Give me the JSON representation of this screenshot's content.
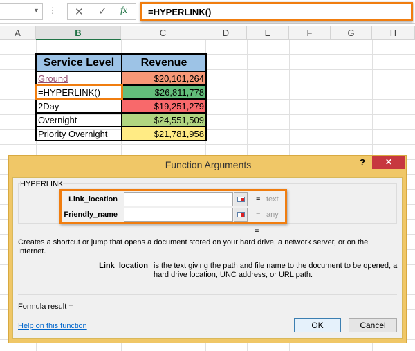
{
  "formula_bar": {
    "formula": "=HYPERLINK()",
    "cancel_icon": "x-icon",
    "enter_icon": "check-icon",
    "fx_label": "fx"
  },
  "columns": [
    "A",
    "B",
    "C",
    "D",
    "E",
    "F",
    "G",
    "H"
  ],
  "table": {
    "headers": [
      "Service Level",
      "Revenue"
    ],
    "rows": [
      {
        "label": "Ground",
        "value": "$20,101,264",
        "color": "#f79877"
      },
      {
        "label": "=HYPERLINK()",
        "value": "$26,811,778",
        "color": "#63be7b"
      },
      {
        "label": "2Day",
        "value": "$19,251,279",
        "color": "#f8696b"
      },
      {
        "label": "Overnight",
        "value": "$24,551,509",
        "color": "#b1d580"
      },
      {
        "label": "Priority Overnight",
        "value": "$21,781,958",
        "color": "#ffeb84"
      }
    ]
  },
  "dialog": {
    "title": "Function Arguments",
    "help_mark": "?",
    "close": "✕",
    "function_name": "HYPERLINK",
    "args": [
      {
        "name": "Link_location",
        "value": "",
        "hint": "text"
      },
      {
        "name": "Friendly_name",
        "value": "",
        "hint": "any"
      }
    ],
    "equals": "=",
    "description": "Creates a shortcut or jump that opens a document stored on your hard drive, a network server, or on the Internet.",
    "arg_help_name": "Link_location",
    "arg_help_text": "is the text giving the path and file name to the document to be opened, a hard drive location, UNC address, or URL path.",
    "formula_result": "Formula result =",
    "help_link": "Help on this function",
    "ok": "OK",
    "cancel": "Cancel"
  },
  "accent": "#f07d0f"
}
